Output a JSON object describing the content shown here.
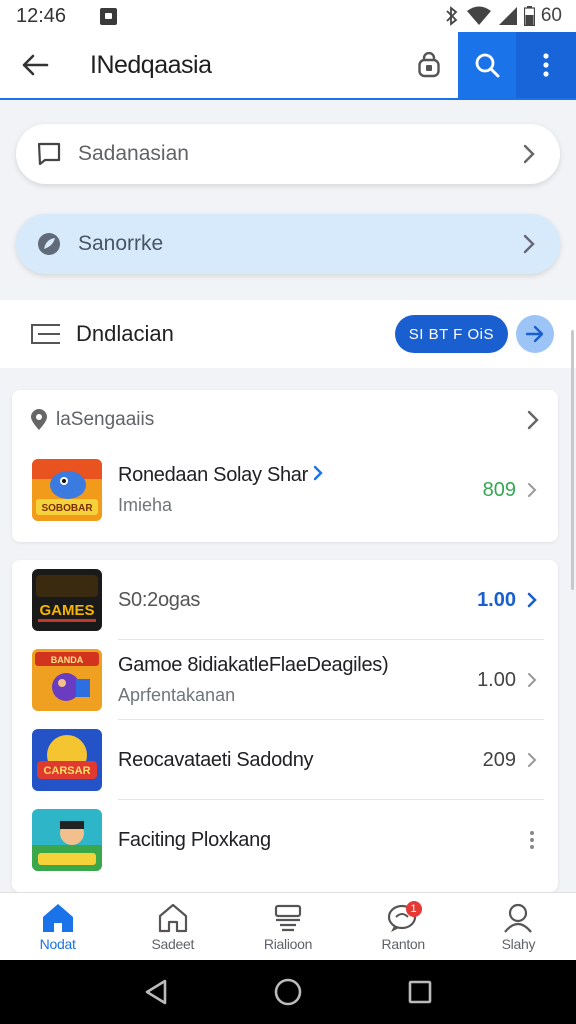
{
  "status_bar": {
    "time": "12:46",
    "battery": "60"
  },
  "header": {
    "title": "INedqaasia"
  },
  "pills": [
    {
      "label": "Sadanasian"
    },
    {
      "label": "Sanorrke"
    }
  ],
  "section": {
    "title": "Dndlacian",
    "button": "SI BT F OiS"
  },
  "card1": {
    "header": "laSengaaiis",
    "rows": [
      {
        "title": "Ronedaan  Solay Shar",
        "subtitle": "Imieha",
        "value": "809"
      }
    ]
  },
  "card2": {
    "rows": [
      {
        "title": "S0:2ogas",
        "subtitle": "",
        "value": "1.00"
      },
      {
        "title": "Gamoe 8idiakatleFlaeDeagiles)",
        "subtitle": "Aprfentakanan",
        "value": "1.00"
      },
      {
        "title": "Reocavataeti Sadodny",
        "subtitle": "",
        "value": "209"
      },
      {
        "title": "Faciting Ploxkang",
        "subtitle": "",
        "value": ""
      }
    ]
  },
  "thumbs": [
    "SOBOBAR",
    "GAMES",
    "BANDA",
    "CARSAR",
    ""
  ],
  "bottom_nav": [
    {
      "label": "Nodat",
      "icon": "home-icon"
    },
    {
      "label": "Sadeet",
      "icon": "house-outline-icon"
    },
    {
      "label": "Rialioon",
      "icon": "inbox-icon"
    },
    {
      "label": "Ranton",
      "icon": "chat-icon",
      "badge": "1"
    },
    {
      "label": "Slahy",
      "icon": "person-icon"
    }
  ],
  "colors": {
    "accent": "#1a73e8",
    "value_green": "#34a853",
    "value_blue": "#1a5fd0"
  }
}
